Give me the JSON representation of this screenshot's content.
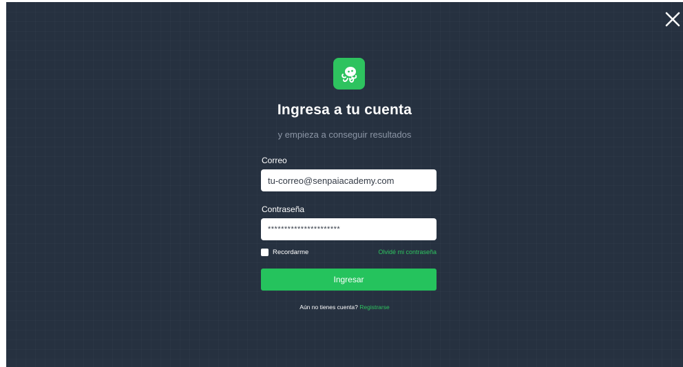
{
  "modal": {
    "close_icon": "close-icon",
    "logo_icon": "octopus-logo-icon",
    "title": "Ingresa a tu cuenta",
    "subtitle": "y empieza a conseguir resultados"
  },
  "form": {
    "email_label": "Correo",
    "email_value": "tu-correo@senpaiacademy.com",
    "password_label": "Contraseña",
    "password_value": "**********************",
    "remember_label": "Recordarme",
    "remember_checked": false,
    "forgot_link": "Olvidé mi contraseña",
    "submit_label": "Ingresar",
    "signup_prompt": "Aún no tienes cuenta?",
    "signup_link": "Registrarse"
  },
  "colors": {
    "background": "#263140",
    "accent": "#25c35d",
    "subtitle": "#8c96a6"
  }
}
